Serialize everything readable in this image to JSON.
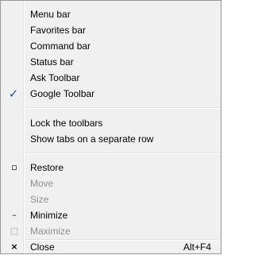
{
  "menu": {
    "toolbars": [
      {
        "label": "Menu bar",
        "checked": false
      },
      {
        "label": "Favorites bar",
        "checked": false
      },
      {
        "label": "Command bar",
        "checked": false
      },
      {
        "label": "Status bar",
        "checked": false
      },
      {
        "label": "Ask Toolbar",
        "checked": false
      },
      {
        "label": "Google Toolbar",
        "checked": true
      }
    ],
    "toolbar_options": [
      {
        "label": "Lock the toolbars"
      },
      {
        "label": "Show tabs on a separate row"
      }
    ],
    "window_commands": [
      {
        "label": "Restore",
        "enabled": true,
        "icon": "restore-icon",
        "glyph": "▫"
      },
      {
        "label": "Move",
        "enabled": false
      },
      {
        "label": "Size",
        "enabled": false
      },
      {
        "label": "Minimize",
        "enabled": true,
        "icon": "minimize-icon",
        "glyph": "–"
      },
      {
        "label": "Maximize",
        "enabled": false,
        "icon": "maximize-icon",
        "glyph": "□"
      }
    ],
    "close": {
      "label": "Close",
      "shortcut": "Alt+F4",
      "icon": "close-icon",
      "glyph": "×"
    },
    "check_glyph": "✓"
  }
}
